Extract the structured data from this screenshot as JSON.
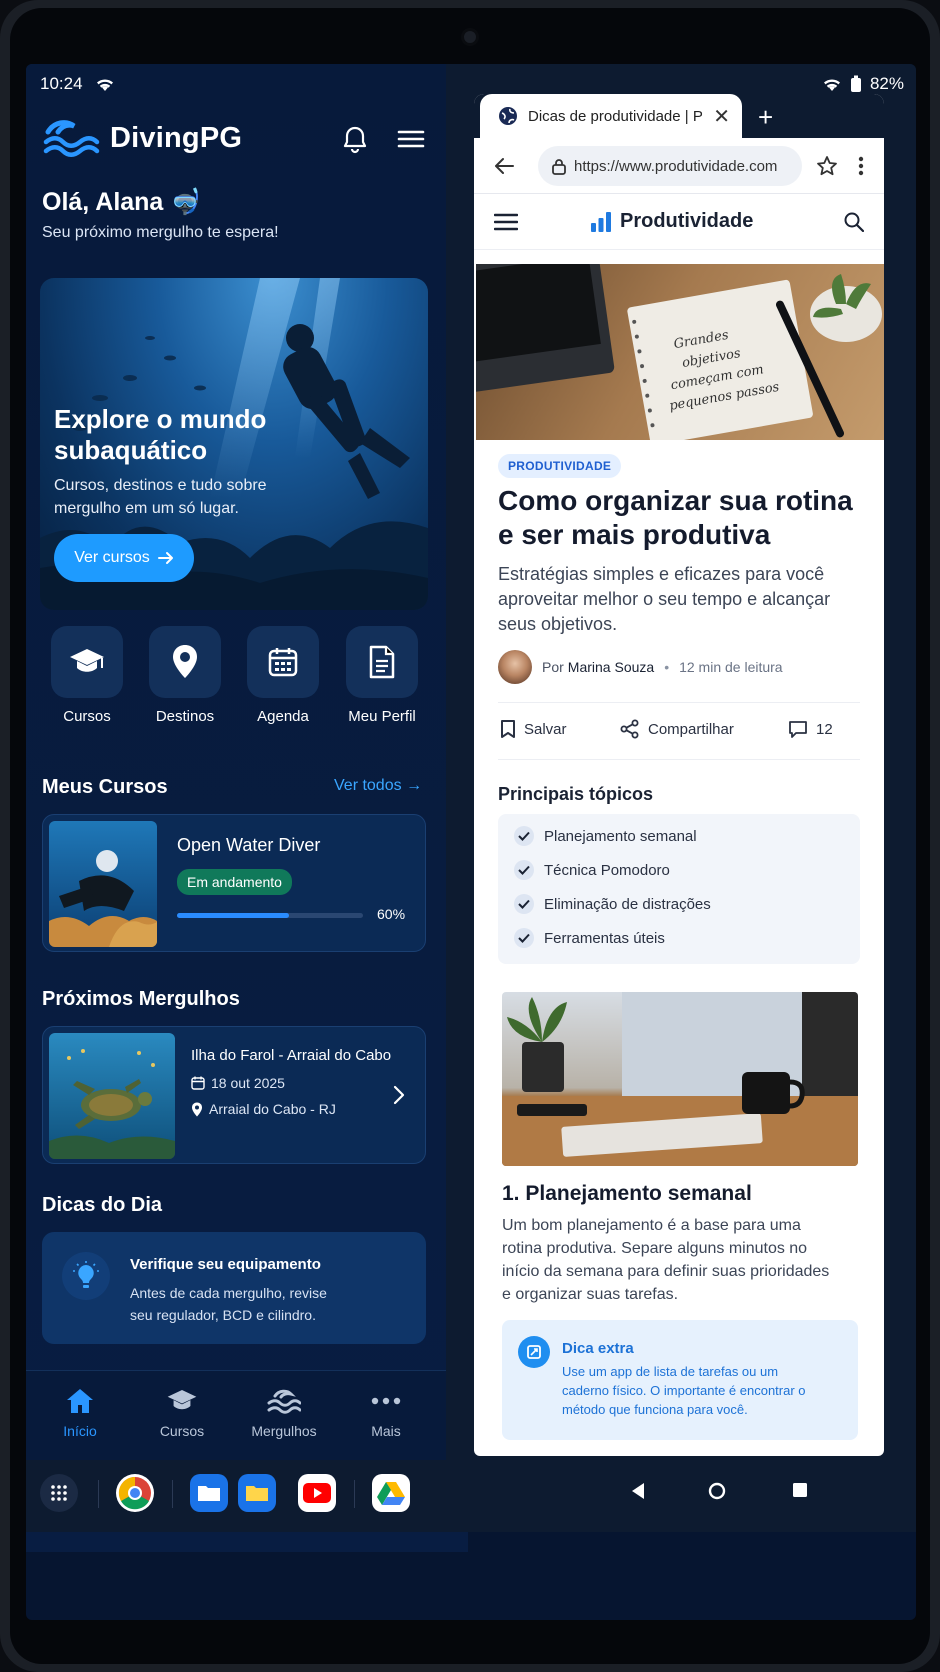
{
  "status": {
    "time": "10:24",
    "battery": "82%"
  },
  "app": {
    "brand": "DivingPG",
    "greeting": "Olá, Alana 🤿",
    "greeting_sub": "Seu próximo mergulho te espera!",
    "hero": {
      "title": "Explore o mundo subaquático",
      "desc": "Cursos, destinos e tudo sobre mergulho em um só lugar.",
      "button": "Ver cursos"
    },
    "quick": [
      {
        "label": "Cursos",
        "icon": "graduation-cap-icon"
      },
      {
        "label": "Destinos",
        "icon": "location-pin-icon"
      },
      {
        "label": "Agenda",
        "icon": "calendar-icon"
      },
      {
        "label": "Meu Perfil",
        "icon": "document-icon"
      }
    ],
    "my_courses": {
      "title": "Meus Cursos",
      "see_all": "Ver todos",
      "course": {
        "name": "Open Water Diver",
        "status": "Em andamento",
        "progress": 0.6,
        "progress_label": "60%"
      }
    },
    "next_dives": {
      "title": "Próximos Mergulhos",
      "dive": {
        "name": "Ilha do Farol - Arraial do Cabo",
        "date": "18 out 2025",
        "place": "Arraial do Cabo - RJ"
      }
    },
    "tips": {
      "title": "Dicas do Dia",
      "tip_title": "Verifique seu equipamento",
      "tip_text": "Antes de cada mergulho, revise seu regulador, BCD e cilindro."
    },
    "tabs": [
      {
        "label": "Início",
        "icon": "home-icon",
        "active": true
      },
      {
        "label": "Cursos",
        "icon": "graduation-cap-icon",
        "active": false
      },
      {
        "label": "Mergulhos",
        "icon": "waves-icon",
        "active": false
      },
      {
        "label": "Mais",
        "icon": "more-icon",
        "active": false
      }
    ]
  },
  "browser": {
    "tab_title": "Dicas de produtividade | P",
    "url": "https://www.produtividade.com",
    "site_name": "Produtividade",
    "image_caption": "Grandes objetivos começam com pequenos passos",
    "category": "PRODUTIVIDADE",
    "title": "Como organizar sua rotina e ser mais produtiva",
    "subtitle": "Estratégias simples e eficazes para você aproveitar melhor o seu tempo e alcançar seus objetivos.",
    "byline_prefix": "Por",
    "author": "Marina Souza",
    "read_time": "12 min de leitura",
    "actions": {
      "save": "Salvar",
      "share": "Compartilhar",
      "comments": "12"
    },
    "topics_title": "Principais tópicos",
    "topics": [
      "Planejamento semanal",
      "Técnica Pomodoro",
      "Eliminação de distrações",
      "Ferramentas úteis"
    ],
    "section_title": "1. Planejamento semanal",
    "section_text": "Um bom planejamento é a base para uma rotina produtiva. Separe alguns minutos no início da semana para definir suas prioridades e organizar suas tarefas.",
    "extra_title": "Dica extra",
    "extra_text": "Use um app de lista de tarefas ou um caderno físico. O importante é encontrar o método que funciona para você."
  },
  "colors": {
    "accent": "#1e9bff",
    "app_bg": "#071a3b",
    "status_green": "#10795a",
    "link_blue": "#1d72d6"
  }
}
